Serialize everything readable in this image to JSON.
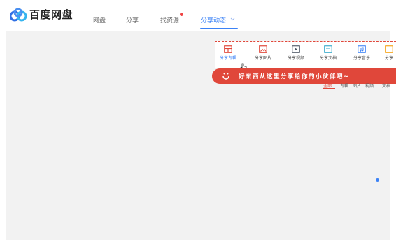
{
  "app": {
    "logo_text": "百度网盘"
  },
  "nav": {
    "items": [
      {
        "label": "网盘"
      },
      {
        "label": "分享"
      },
      {
        "label": "找资源"
      },
      {
        "label": "分享动态"
      }
    ],
    "active_index": 3
  },
  "share_menu": {
    "items": [
      {
        "label": "分享专辑",
        "icon": "album-icon"
      },
      {
        "label": "分享图片",
        "icon": "image-icon"
      },
      {
        "label": "分享视频",
        "icon": "video-icon"
      },
      {
        "label": "分享文档",
        "icon": "document-icon"
      },
      {
        "label": "分享音乐",
        "icon": "music-icon"
      },
      {
        "label": "分享",
        "icon": "other-icon"
      }
    ]
  },
  "banner": {
    "text": "好东西从这里分享给你的小伙伴吧~"
  },
  "filter_tabs": {
    "items": [
      {
        "label": "全部"
      },
      {
        "label": "专辑"
      },
      {
        "label": "图片"
      },
      {
        "label": "视频"
      },
      {
        "label": "文档"
      }
    ],
    "active_index": 0
  },
  "colors": {
    "accent_blue": "#3b82f6",
    "accent_red": "#e0473a"
  }
}
